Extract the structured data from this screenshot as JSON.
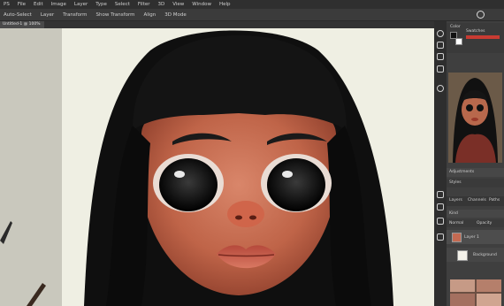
{
  "menu": [
    "PS",
    "File",
    "Edit",
    "Image",
    "Layer",
    "Type",
    "Select",
    "Filter",
    "3D",
    "View",
    "Window",
    "Help"
  ],
  "options": [
    "Auto-Select",
    "Layer",
    "Transform",
    "Show Transform",
    "Align",
    "3D Mode"
  ],
  "doc_tab": "Untitled-1 @ 100%",
  "panel": {
    "color_label": "Color",
    "swatch_label": "Swatches",
    "adjust_label": "Adjustments",
    "styles_label": "Styles",
    "layers_tab": "Layers",
    "channels_tab": "Channels",
    "paths_tab": "Paths",
    "kind_label": "Kind",
    "normal_label": "Normal",
    "opacity_label": "Opacity",
    "layer_name": "Layer 1",
    "bg_layer": "Background",
    "colors": {
      "accent": "#c83b32",
      "panel_bg": "#3f3f3f"
    }
  }
}
